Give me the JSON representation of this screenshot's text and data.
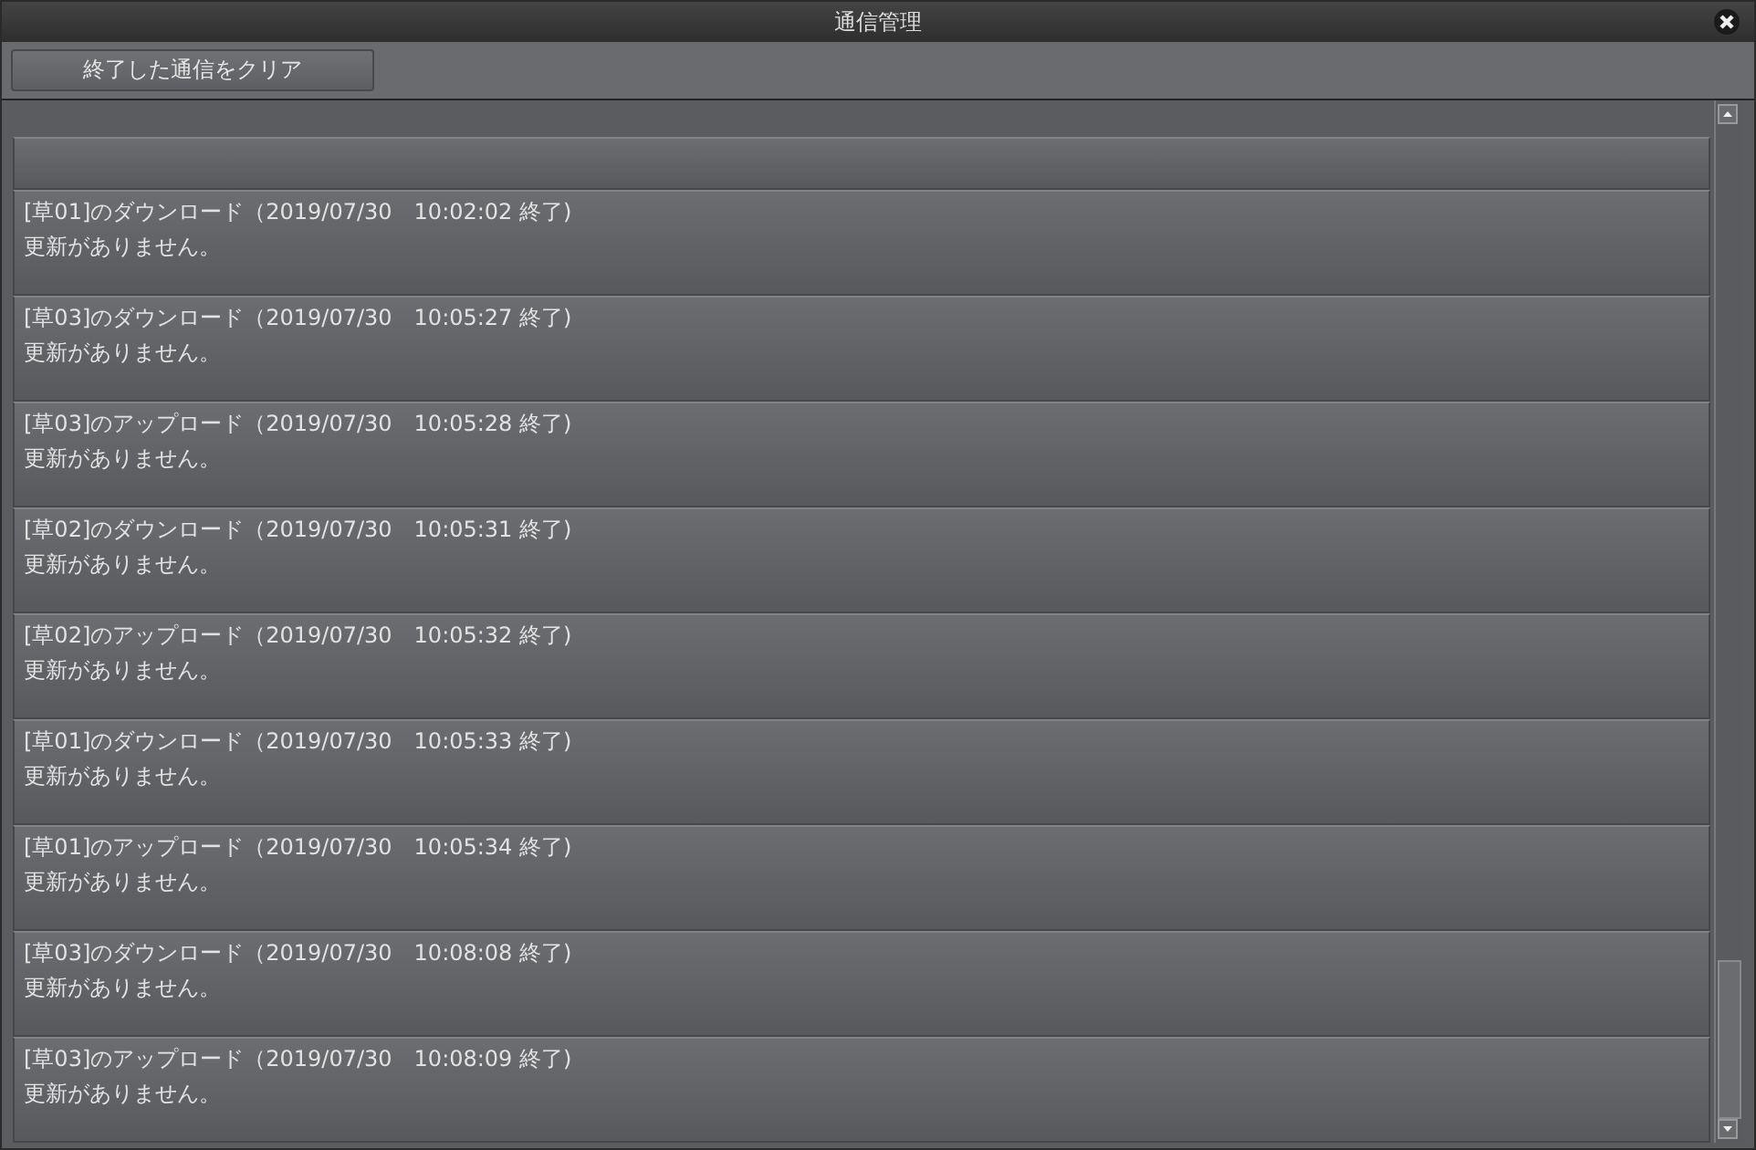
{
  "window": {
    "title": "通信管理"
  },
  "toolbar": {
    "clear_button": "終了した通信をクリア"
  },
  "items": [
    {
      "title": "[草01]のダウンロード（2019/07/30　10:02:02 終了)",
      "message": "更新がありません。"
    },
    {
      "title": "[草03]のダウンロード（2019/07/30　10:05:27 終了)",
      "message": "更新がありません。"
    },
    {
      "title": "[草03]のアップロード（2019/07/30　10:05:28 終了)",
      "message": "更新がありません。"
    },
    {
      "title": "[草02]のダウンロード（2019/07/30　10:05:31 終了)",
      "message": "更新がありません。"
    },
    {
      "title": "[草02]のアップロード（2019/07/30　10:05:32 終了)",
      "message": "更新がありません。"
    },
    {
      "title": "[草01]のダウンロード（2019/07/30　10:05:33 終了)",
      "message": "更新がありません。"
    },
    {
      "title": "[草01]のアップロード（2019/07/30　10:05:34 終了)",
      "message": "更新がありません。"
    },
    {
      "title": "[草03]のダウンロード（2019/07/30　10:08:08 終了)",
      "message": "更新がありません。"
    },
    {
      "title": "[草03]のアップロード（2019/07/30　10:08:09 終了)",
      "message": "更新がありません。"
    }
  ]
}
